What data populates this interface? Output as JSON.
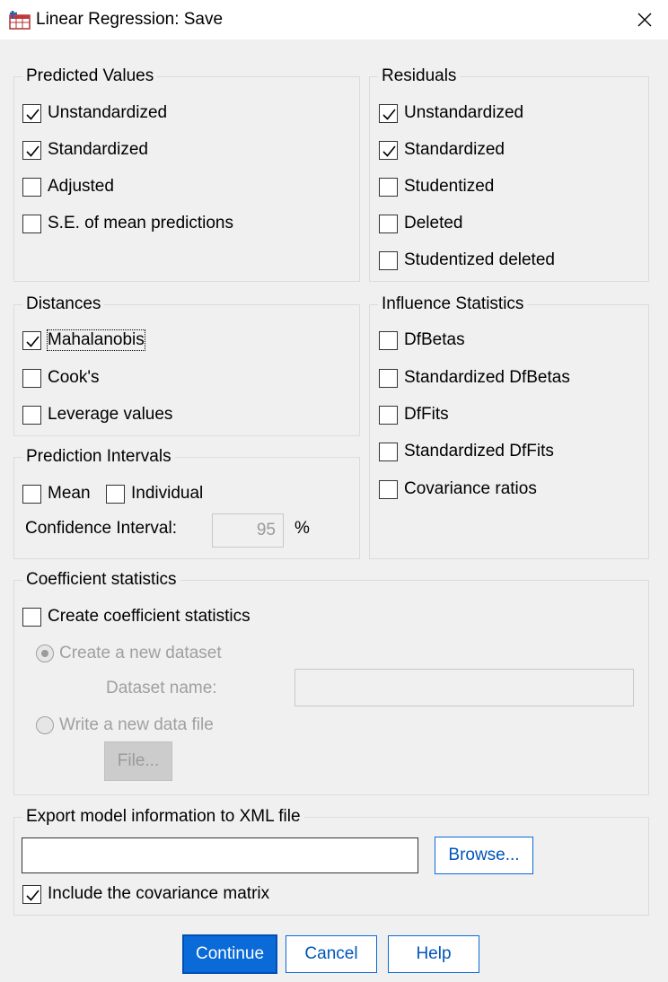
{
  "window": {
    "title": "Linear Regression: Save"
  },
  "predicted": {
    "legend": "Predicted Values",
    "items": [
      {
        "label": "Unstandardized",
        "checked": true
      },
      {
        "label": "Standardized",
        "checked": true
      },
      {
        "label": "Adjusted",
        "checked": false
      },
      {
        "label": "S.E. of mean predictions",
        "checked": false
      }
    ]
  },
  "residuals": {
    "legend": "Residuals",
    "items": [
      {
        "label": "Unstandardized",
        "checked": true
      },
      {
        "label": "Standardized",
        "checked": true
      },
      {
        "label": "Studentized",
        "checked": false
      },
      {
        "label": "Deleted",
        "checked": false
      },
      {
        "label": "Studentized deleted",
        "checked": false
      }
    ]
  },
  "distances": {
    "legend": "Distances",
    "items": [
      {
        "label": "Mahalanobis",
        "checked": true
      },
      {
        "label": "Cook's",
        "checked": false
      },
      {
        "label": "Leverage values",
        "checked": false
      }
    ]
  },
  "influence": {
    "legend": "Influence Statistics",
    "items": [
      {
        "label": "DfBetas",
        "checked": false
      },
      {
        "label": "Standardized DfBetas",
        "checked": false
      },
      {
        "label": "DfFits",
        "checked": false
      },
      {
        "label": "Standardized DfFits",
        "checked": false
      },
      {
        "label": "Covariance ratios",
        "checked": false
      }
    ]
  },
  "prediction_intervals": {
    "legend": "Prediction Intervals",
    "mean_label": "Mean",
    "mean_checked": false,
    "individual_label": "Individual",
    "individual_checked": false,
    "ci_label": "Confidence Interval:",
    "ci_value": "95",
    "ci_unit": "%"
  },
  "coefficient": {
    "legend": "Coefficient statistics",
    "create_label": "Create coefficient statistics",
    "create_checked": false,
    "new_dataset_label": "Create a new dataset",
    "new_dataset_selected": true,
    "dataset_name_label": "Dataset name:",
    "dataset_name_value": "",
    "write_file_label": "Write a new data file",
    "write_file_selected": false,
    "file_button": "File..."
  },
  "export": {
    "legend": "Export model information to XML file",
    "path_value": "",
    "browse_button": "Browse...",
    "include_cov_label": "Include the covariance matrix",
    "include_cov_checked": true
  },
  "buttons": {
    "continue": "Continue",
    "cancel": "Cancel",
    "help": "Help"
  },
  "colors": {
    "accent": "#0a6ad8",
    "window_bg": "#f0f0f0",
    "disabled_text": "#a0a0a0"
  },
  "icons": {
    "app": "spss-table-icon",
    "close": "close-icon",
    "check": "check-icon"
  }
}
